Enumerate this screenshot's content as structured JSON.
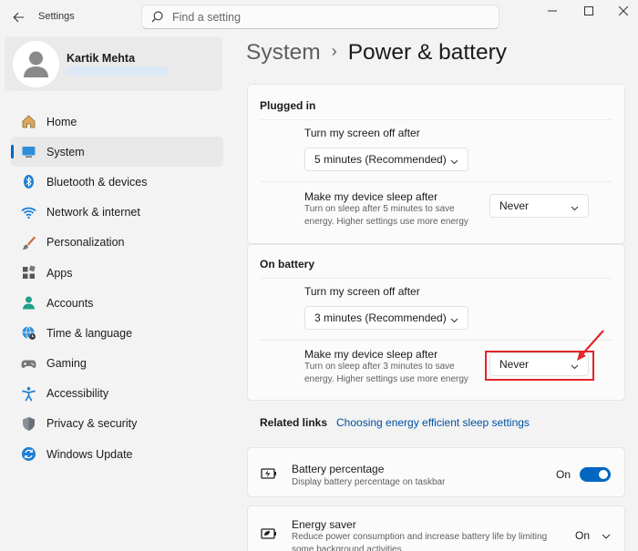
{
  "app": {
    "title": "Settings"
  },
  "search": {
    "placeholder": "Find a setting"
  },
  "profile": {
    "name": "Kartik Mehta"
  },
  "nav": {
    "items": [
      {
        "label": "Home",
        "icon": "home-icon"
      },
      {
        "label": "System",
        "icon": "system-icon",
        "active": true
      },
      {
        "label": "Bluetooth & devices",
        "icon": "bluetooth-icon"
      },
      {
        "label": "Network & internet",
        "icon": "wifi-icon"
      },
      {
        "label": "Personalization",
        "icon": "brush-icon"
      },
      {
        "label": "Apps",
        "icon": "apps-icon"
      },
      {
        "label": "Accounts",
        "icon": "person-icon"
      },
      {
        "label": "Time & language",
        "icon": "globe-clock-icon"
      },
      {
        "label": "Gaming",
        "icon": "gamepad-icon"
      },
      {
        "label": "Accessibility",
        "icon": "accessibility-icon"
      },
      {
        "label": "Privacy & security",
        "icon": "shield-icon"
      },
      {
        "label": "Windows Update",
        "icon": "update-icon"
      }
    ]
  },
  "header": {
    "crumb": "System",
    "separator": "›",
    "title": "Power & battery"
  },
  "plugged_in": {
    "label": "Plugged in",
    "screen_off_title": "Turn my screen off after",
    "screen_off_value": "5 minutes (Recommended)",
    "sleep_title": "Make my device sleep after",
    "sleep_desc": "Turn on sleep after 5 minutes to save energy. Higher settings use more energy",
    "sleep_value": "Never"
  },
  "on_battery": {
    "label": "On battery",
    "screen_off_title": "Turn my screen off after",
    "screen_off_value": "3 minutes (Recommended)",
    "sleep_title": "Make my device sleep after",
    "sleep_desc": "Turn on sleep after 3 minutes to save energy. Higher settings use more energy",
    "sleep_value": "Never"
  },
  "related": {
    "label": "Related links",
    "link": "Choosing energy efficient sleep settings"
  },
  "battery_percentage": {
    "title": "Battery percentage",
    "desc": "Display battery percentage on taskbar",
    "state": "On"
  },
  "energy_saver": {
    "title": "Energy saver",
    "desc": "Reduce power consumption and increase battery life by limiting some background activities",
    "state": "On"
  },
  "colors": {
    "accent": "#0067c0",
    "annotation": "#e3262a",
    "link": "#0050a0"
  }
}
